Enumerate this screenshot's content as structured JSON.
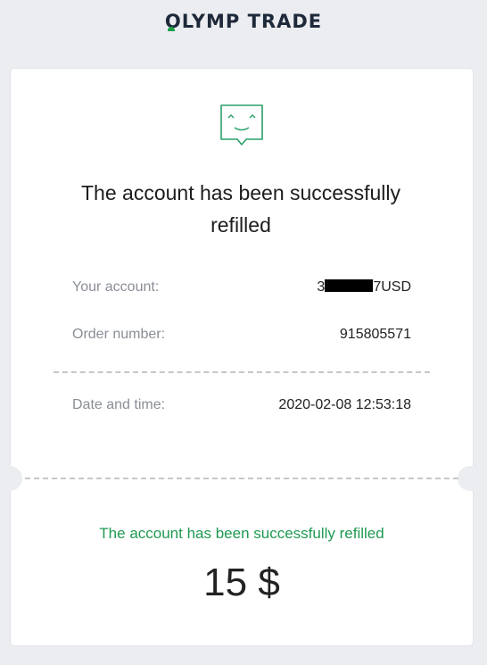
{
  "header": {
    "logo_text_left": "OLYMP",
    "logo_text_right": "TRADE"
  },
  "receipt": {
    "title": "The account has been successfully refilled",
    "account_label": "Your account:",
    "account_prefix": "3",
    "account_suffix": "7USD",
    "order_label": "Order number:",
    "order_value": "915805571",
    "date_label": "Date and time:",
    "date_value": "2020-02-08 12:53:18"
  },
  "result": {
    "message": "The account has been successfully refilled",
    "amount": "15 $"
  },
  "icons": {
    "mascot": "smiling-chat-bubble-icon"
  },
  "colors": {
    "accent_green": "#1f9a52",
    "logo_red": "#e0312d",
    "background": "#ebedf0"
  }
}
